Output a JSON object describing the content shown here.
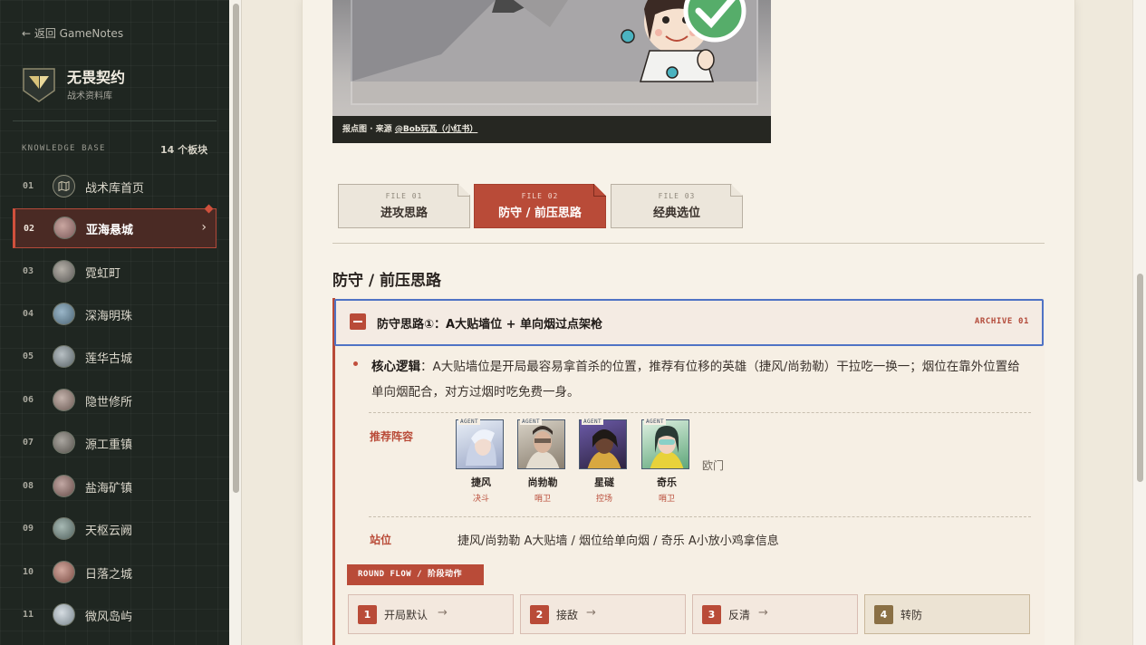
{
  "sidebar": {
    "back_link": "← 返回 GameNotes",
    "brand_title": "无畏契约",
    "brand_subtitle": "战术资料库",
    "kb_label": "KNOWLEDGE BASE",
    "kb_count": "14 个板块",
    "items": [
      {
        "num": "01",
        "label": "战术库首页",
        "icon": "map-icon"
      },
      {
        "num": "02",
        "label": "亚海悬城",
        "icon": "map-thumbnail",
        "active": true
      },
      {
        "num": "03",
        "label": "霓虹町",
        "icon": "map-thumbnail"
      },
      {
        "num": "04",
        "label": "深海明珠",
        "icon": "map-thumbnail"
      },
      {
        "num": "05",
        "label": "莲华古城",
        "icon": "map-thumbnail"
      },
      {
        "num": "06",
        "label": "隐世修所",
        "icon": "map-thumbnail"
      },
      {
        "num": "07",
        "label": "源工重镇",
        "icon": "map-thumbnail"
      },
      {
        "num": "08",
        "label": "盐海矿镇",
        "icon": "map-thumbnail"
      },
      {
        "num": "09",
        "label": "天枢云阙",
        "icon": "map-thumbnail"
      },
      {
        "num": "10",
        "label": "日落之城",
        "icon": "map-thumbnail"
      },
      {
        "num": "11",
        "label": "微风岛屿",
        "icon": "map-thumbnail"
      }
    ]
  },
  "map": {
    "caption_prefix": "报点图 · 来源",
    "caption_source": "@Bob玩瓦（小红书）"
  },
  "tabs": [
    {
      "no": "FILE 01",
      "name": "进攻思路"
    },
    {
      "no": "FILE 02",
      "name": "防守 / 前压思路",
      "active": true
    },
    {
      "no": "FILE 03",
      "name": "经典选位"
    }
  ],
  "section_title": "防守 / 前压思路",
  "card": {
    "title": "防守思路①：A大贴墙位 + 单向烟过点架枪",
    "archive": "ARCHIVE 01",
    "core_label": "核心逻辑",
    "core_text": "：A大贴墙位是开局最容易拿首杀的位置，推荐有位移的英雄（捷风/尚勃勒）干拉吃一换一；烟位在靠外位置给单向烟配合，对方过烟时吃免费一身。",
    "lineup_label": "推荐阵容",
    "agent_tag": "AGENT",
    "agents": [
      {
        "name": "捷风",
        "role": "决斗"
      },
      {
        "name": "尚勃勒",
        "role": "哨卫"
      },
      {
        "name": "星礈",
        "role": "控场"
      },
      {
        "name": "奇乐",
        "role": "哨卫"
      }
    ],
    "agent_extra": "欧门",
    "position_label": "站位",
    "position_text": "捷风/尚勃勒 A大贴墙 / 烟位给单向烟 / 奇乐 A小放小鸡拿信息",
    "round_flow_label": "ROUND FLOW / 阶段动作",
    "steps": [
      {
        "num": "1",
        "label": "开局默认",
        "arrow": "→"
      },
      {
        "num": "2",
        "label": "接敌",
        "arrow": "→"
      },
      {
        "num": "3",
        "label": "反清",
        "arrow": "→"
      },
      {
        "num": "4",
        "label": "转防",
        "arrow": ""
      }
    ]
  },
  "colors": {
    "accent": "#b94b38",
    "sidebar_bg": "#1f2621",
    "paper": "#f7f2e8",
    "header_outline": "#4f73c5"
  }
}
